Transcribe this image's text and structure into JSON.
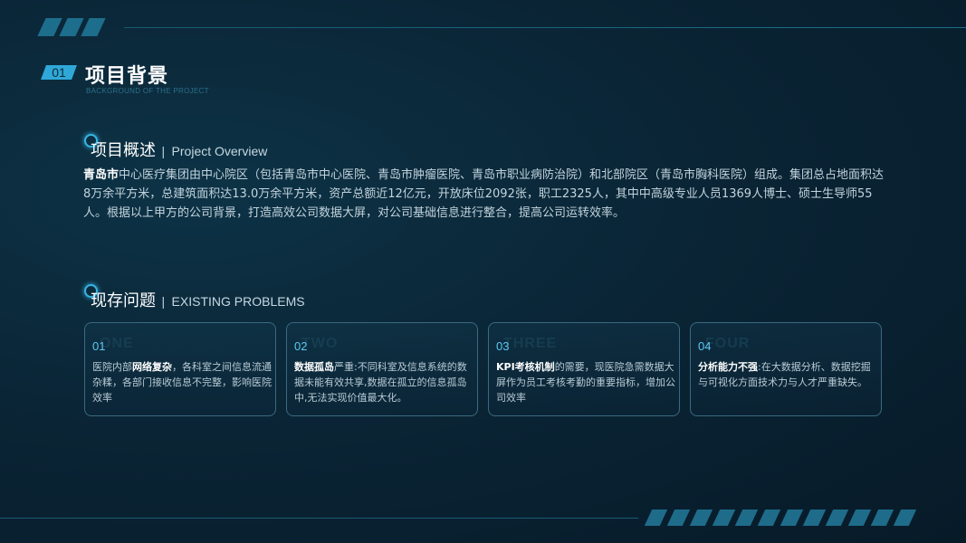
{
  "header": {
    "section_number": "01",
    "title": "项目背景",
    "subtitle": "BACKGROUND OF THE PROJECT"
  },
  "overview": {
    "heading": "项目概述",
    "separator": "|",
    "heading_en": "Project Overview",
    "text_highlight": "青岛市",
    "text": "中心医疗集团由中心院区（包括青岛市中心医院、青岛市肿瘤医院、青岛市职业病防治院）和北部院区（青岛市胸科医院）组成。集团总占地面积达8万余平方米，总建筑面积达13.0万余平方米，资产总额近12亿元，开放床位2092张，职工2325人，其中中高级专业人员1369人博士、硕士生导师55人。根据以上甲方的公司背景，打造高效公司数据大屏，对公司基础信息进行整合，提高公司运转效率。"
  },
  "problems": {
    "heading": "现存问题",
    "separator": "|",
    "heading_en": "EXISTING PROBLEMS",
    "cards": [
      {
        "num": "01",
        "ghost": "ONE",
        "lead": "医院内部",
        "bold": "网络复杂",
        "rest": "，各科室之间信息流通杂糅，各部门接收信息不完整，影响医院效率"
      },
      {
        "num": "02",
        "ghost": "TWO",
        "lead": "",
        "bold": "数据孤岛",
        "rest": "严重:不同科室及信息系统的数据未能有效共享,数据在孤立的信息孤岛中,无法实现价值最大化。"
      },
      {
        "num": "03",
        "ghost": "THREE",
        "lead": "",
        "bold": "KPI考核机制",
        "rest": "的需要，现医院急需数据大屏作为员工考核考勤的重要指标，增加公司效率"
      },
      {
        "num": "04",
        "ghost": "FOUR",
        "lead": "",
        "bold": "分析能力不强",
        "rest": ":在大数据分析、数据挖掘与可视化方面技术力与人才严重缺失。"
      }
    ]
  },
  "colors": {
    "accent": "#37b6e4",
    "background": "#0a2536",
    "card_border": "#3b6a80"
  }
}
